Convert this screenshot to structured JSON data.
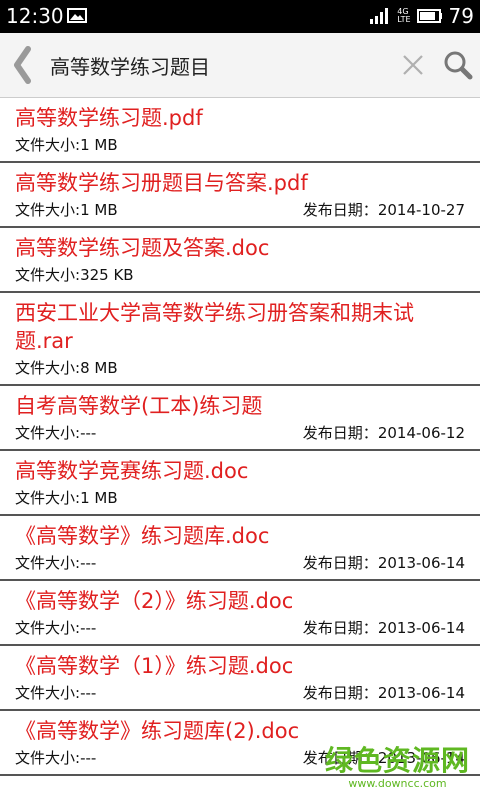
{
  "status_bar": {
    "time": "12:30",
    "network": [
      "4G",
      "LTE"
    ],
    "battery_level": "79"
  },
  "search": {
    "query": "高等数学练习题目"
  },
  "meta_labels": {
    "size": "文件大小:",
    "date": "发布日期："
  },
  "results": [
    {
      "title": "高等数学练习题.pdf",
      "size": "1 MB",
      "date": ""
    },
    {
      "title": "高等数学练习册题目与答案.pdf",
      "size": "1 MB",
      "date": "2014-10-27"
    },
    {
      "title": "高等数学练习题及答案.doc",
      "size": "325 KB",
      "date": ""
    },
    {
      "title": "西安工业大学高等数学练习册答案和期末试题.rar",
      "size": "8 MB",
      "date": ""
    },
    {
      "title": "自考高等数学(工本)练习题",
      "size": "---",
      "date": "2014-06-12"
    },
    {
      "title": "高等数学竞赛练习题.doc",
      "size": "1 MB",
      "date": ""
    },
    {
      "title": "《高等数学》练习题库.doc",
      "size": "---",
      "date": "2013-06-14"
    },
    {
      "title": "《高等数学（2）》练习题.doc",
      "size": "---",
      "date": "2013-06-14"
    },
    {
      "title": "《高等数学（1）》练习题.doc",
      "size": "---",
      "date": "2013-06-14"
    },
    {
      "title": "《高等数学》练习题库(2).doc",
      "size": "---",
      "date": "2013-06-14"
    }
  ],
  "watermark": {
    "main": "绿色资源网",
    "sub": "www.downcc.com"
  },
  "colors": {
    "title_red": "#e02020",
    "watermark_green": "#5fb822"
  }
}
